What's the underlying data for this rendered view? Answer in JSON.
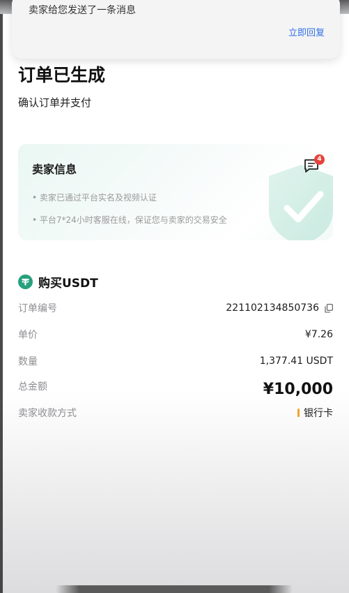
{
  "notification": {
    "message": "卖家给您发送了一条消息",
    "reply_label": "立即回复"
  },
  "page": {
    "title": "订单已生成",
    "subtitle": "确认订单并支付"
  },
  "seller_card": {
    "title": "卖家信息",
    "unread_count": "4",
    "points": [
      "• 卖家已通过平台实名及视频认证",
      "• 平台7*24小时客服在线，保证您与卖家的交易安全"
    ],
    "icons": {
      "message": "message-icon",
      "shield": "shield-check-icon"
    }
  },
  "order": {
    "buy_label": "购买USDT",
    "icon": "tether-icon",
    "rows": [
      {
        "label": "订单编号",
        "value": "221102134850736"
      },
      {
        "label": "单价",
        "value": "¥7.26"
      },
      {
        "label": "数量",
        "value": "1,377.41 USDT"
      },
      {
        "label": "总金额",
        "value": "¥10,000"
      },
      {
        "label": "卖家收款方式",
        "value": "银行卡"
      }
    ]
  },
  "colors": {
    "accent_blue": "#2f6fe4",
    "tether_green": "#26a17b",
    "badge_red": "#e5433c",
    "bank_bar": "#f0a431"
  }
}
